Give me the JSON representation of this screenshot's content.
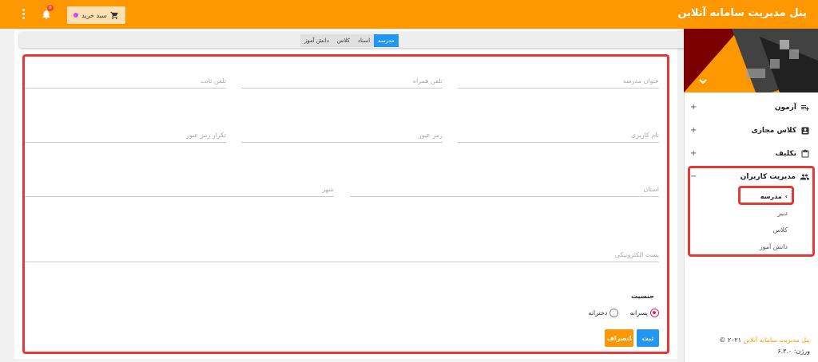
{
  "header": {
    "brand": "پنل مدیریت سامانه آنلاین",
    "cart_label": "سبد خرید",
    "notifications": "0",
    "icons": [
      "cart-icon",
      "bell-icon",
      "more-vert-icon"
    ]
  },
  "tabs": [
    {
      "label": "مدرسه",
      "active": true
    },
    {
      "label": "استاد",
      "active": false
    },
    {
      "label": "کلاس",
      "active": false
    },
    {
      "label": "دانش آموز",
      "active": false
    }
  ],
  "form": {
    "school_title": "عنوان مدرسه",
    "mobile": "تلفن همراه",
    "phone": "تلفن ثابت",
    "username": "نام کاربری",
    "password": "رمز عبور",
    "password_repeat": "تکرار رمز عبور",
    "province": "استان",
    "city": "شهر",
    "email": "پست الکترونیکی",
    "gender_label": "جنسیت",
    "gender_boys": "پسرانه",
    "gender_girls": "دخترانه",
    "submit": "ثبت",
    "cancel": "انصراف"
  },
  "sidebar": {
    "items": [
      {
        "label": "آزمون",
        "icon": "playlist-add-icon",
        "toggle": "+"
      },
      {
        "label": "کلاس مجازی",
        "icon": "account-box-icon",
        "toggle": "+"
      },
      {
        "label": "تکلیف",
        "icon": "clipboard-icon",
        "toggle": "+"
      },
      {
        "label": "مدیریت کاربران",
        "icon": "group-icon",
        "toggle": "−"
      }
    ],
    "subitems": [
      "مدرسه",
      "دبیر",
      "کلاس",
      "دانش آموز"
    ],
    "footer_brand": "پنل مدیریت سامانه آنلاین",
    "footer_year": "۲۰۲۱",
    "footer_version": "ورژن: ۶.۳.۰"
  },
  "colors": {
    "accent": "#ff9800",
    "primary": "#2196f3",
    "highlight": "#e53935"
  }
}
